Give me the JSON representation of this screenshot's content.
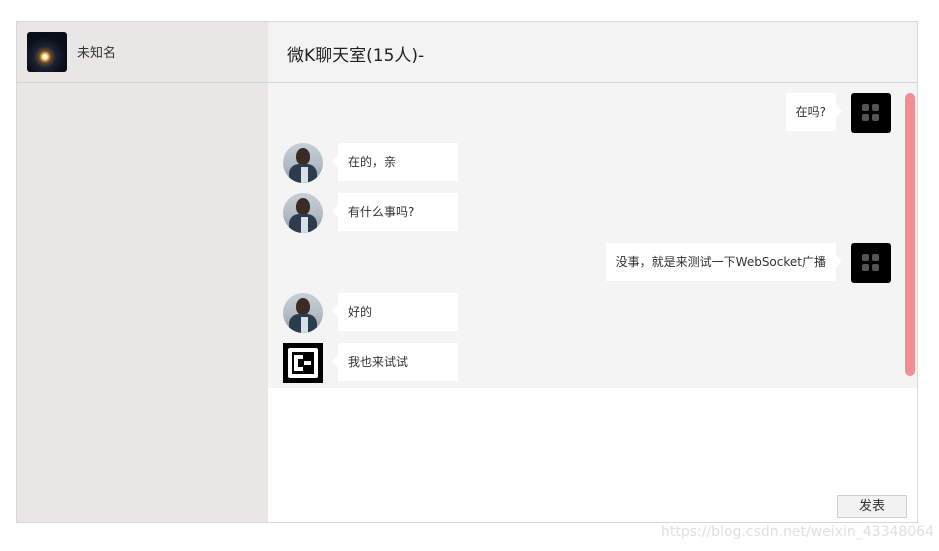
{
  "user": {
    "name": "未知名",
    "avatar_icon": "night-city-avatar-icon"
  },
  "room": {
    "title": "微K聊天室(15人)-"
  },
  "messages": [
    {
      "side": "right",
      "avatar": "blackbox",
      "text": "在吗?"
    },
    {
      "side": "left",
      "avatar": "person",
      "text": "在的，亲"
    },
    {
      "side": "left",
      "avatar": "person",
      "text": "有什么事吗?"
    },
    {
      "side": "right",
      "avatar": "blackbox",
      "text": "没事，就是来测试一下WebSocket广播"
    },
    {
      "side": "left",
      "avatar": "person",
      "text": "好的"
    },
    {
      "side": "left",
      "avatar": "ej",
      "text": "我也来试试"
    }
  ],
  "compose": {
    "placeholder": "",
    "send_label": "发表"
  },
  "colors": {
    "sidebar": "#e8e7e5",
    "chat_bg": "#f4f4f4",
    "scrollbar": "#f28d91"
  },
  "watermark": "https://blog.csdn.net/weixin_43348064"
}
